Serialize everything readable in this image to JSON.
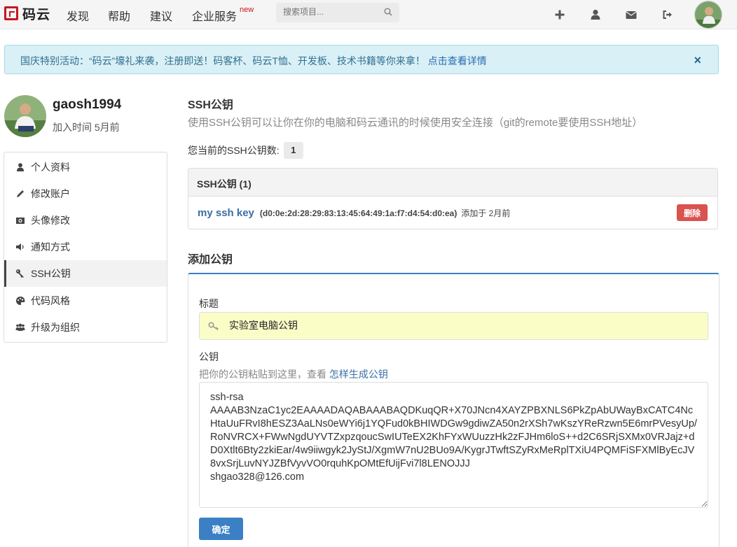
{
  "nav": {
    "logo_text": "码云",
    "items": [
      {
        "label": "发现"
      },
      {
        "label": "帮助"
      },
      {
        "label": "建议"
      },
      {
        "label": "企业服务"
      }
    ],
    "new_badge": "new",
    "search_placeholder": "搜索项目...",
    "icons": [
      "plus-icon",
      "user-icon",
      "envelope-icon",
      "sign-out-icon"
    ]
  },
  "alert": {
    "text": "国庆特别活动：“码云”壕礼来袭，注册即送！码客杯、码云T恤、开发板、技术书籍等你来拿！",
    "link": "点击查看详情",
    "close": "×"
  },
  "profile": {
    "username": "gaosh1994",
    "joined": "加入时间 5月前"
  },
  "sidebar": {
    "items": [
      {
        "label": "个人资料",
        "icon": "user-icon"
      },
      {
        "label": "修改账户",
        "icon": "pencil-icon"
      },
      {
        "label": "头像修改",
        "icon": "camera-icon"
      },
      {
        "label": "通知方式",
        "icon": "volume-icon"
      },
      {
        "label": "SSH公钥",
        "icon": "key-icon",
        "active": true
      },
      {
        "label": "代码风格",
        "icon": "palette-icon"
      },
      {
        "label": "升级为组织",
        "icon": "group-icon"
      }
    ]
  },
  "ssh": {
    "title": "SSH公钥",
    "description": "使用SSH公钥可以让你在你的电脑和码云通讯的时候使用安全连接（git的remote要使用SSH地址）",
    "count_label": "您当前的SSH公钥数:",
    "count": "1",
    "panel_title": "SSH公钥 (1)",
    "keys": [
      {
        "name": "my ssh key",
        "fingerprint": "(d0:0e:2d:28:29:83:13:45:64:49:1a:f7:d4:54:d0:ea)",
        "added": "添加于 2月前",
        "delete_label": "删除"
      }
    ]
  },
  "add_key": {
    "heading": "添加公钥",
    "title_label": "标题",
    "title_value": "实验室电脑公钥",
    "key_label": "公钥",
    "hint_prefix": "把你的公钥粘贴到这里，查看",
    "hint_link": "怎样生成公钥",
    "key_value": "ssh-rsa\nAAAAB3NzaC1yc2EAAAADAQABAAABAQDKuqQR+X70JNcn4XAYZPBXNLS6PkZpAbUWayBxCATC4NcHtaUuFRvI8hESZ3AaLNs0eWYi6j1YQFud0kBHIWDGw9gdiwZA50n2rXSh7wKszYReRzwn5E6mrPVesyUp/RoNVRCX+FWwNgdUYVTZxpzqoucSwIUTeEX2KhFYxWUuzzHk2zFJHm6loS++d2C6SRjSXMx0VRJajz+dD0Xtlt6Bty2zkiEar/4w9iiwgyk2JyStJ/XgmW7nU2BUo9A/KygrJTwftSZyRxMeRplTXiU4PQMFiSFXMlByEcJV8vxSrjLuvNYJZBfVyvVO0rquhKpOMtEfUijFvi7l8LENOJJJ\nshgao328@126.com",
    "submit_label": "确定"
  }
}
